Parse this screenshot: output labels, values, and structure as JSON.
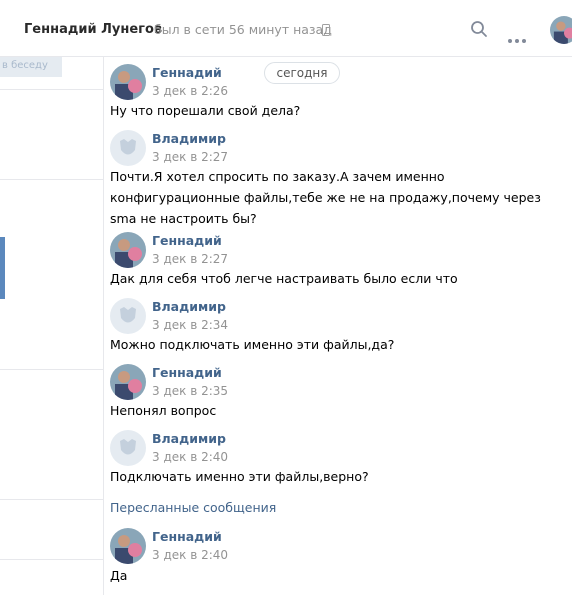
{
  "header": {
    "contact_name": "Геннадий Лунегов",
    "status": "был в сети 56 минут назад",
    "icons": [
      "phone-icon",
      "search-icon",
      "more-icon"
    ]
  },
  "sidebar": {
    "chip_label": "в беседу"
  },
  "date_divider": "сегодня",
  "messages": [
    {
      "author": "Геннадий",
      "time": "3 дек в 2:26",
      "text": [
        "Ну что порешали свой дела?"
      ]
    },
    {
      "author": "Владимир",
      "time": "3 дек в 2:27",
      "text": [
        "Почти.Я хотел спросить по заказу.А зачем именно",
        "конфигурационные файлы,тебе же не на продажу,почему через",
        "sma не настроить бы?"
      ]
    },
    {
      "author": "Геннадий",
      "time": "3 дек в 2:27",
      "text": [
        "Дак для себя чтоб легче настраивать было если что"
      ]
    },
    {
      "author": "Владимир",
      "time": "3 дек в 2:34",
      "text": [
        "Можно подключать именно эти файлы,да?"
      ]
    },
    {
      "author": "Геннадий",
      "time": "3 дек в 2:35",
      "text": [
        "Непонял вопрос"
      ]
    },
    {
      "author": "Владимир",
      "time": "3 дек в 2:40",
      "text": [
        "Подключать именно эти файлы,верно?"
      ]
    }
  ],
  "forwarded": {
    "label": "Пересланные сообщения",
    "messages": [
      {
        "author": "Геннадий",
        "time": "3 дек в 2:40",
        "text": [
          "Да"
        ]
      }
    ]
  },
  "colors": {
    "author_link": "#42648b",
    "muted": "#939393",
    "accent": "#5b88bd"
  }
}
